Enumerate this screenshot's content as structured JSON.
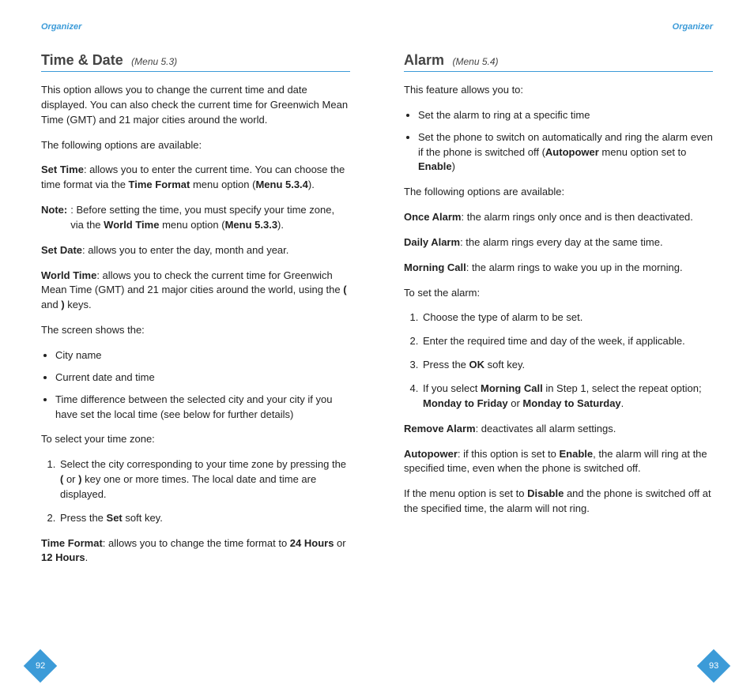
{
  "left": {
    "header": "Organizer",
    "title": "Time & Date",
    "menuRef": "(Menu 5.3)",
    "intro": "This option allows you to change the current time and date displayed. You can also check the current time for Greenwich Mean Time (GMT) and 21 major cities around the world.",
    "optionsIntro": "The following options are available:",
    "setTime": {
      "label": "Set Time",
      "text1": ": allows you to enter the current time. You can choose the time format via the ",
      "bold1": "Time Format",
      "text2": " menu option (",
      "bold2": "Menu 5.3.4",
      "text3": ")."
    },
    "note": {
      "label": "Note",
      "text1": ": Before setting the time, you must specify your time zone, via the ",
      "bold1": "World Time",
      "text2": " menu option (",
      "bold2": "Menu 5.3.3",
      "text3": ")."
    },
    "setDate": {
      "label": "Set Date",
      "text": ": allows you to enter the day, month and year."
    },
    "worldTime": {
      "label": "World Time",
      "text1": ": allows you to check the current time for Greenwich Mean Time (GMT) and 21 major cities around the world, using the ",
      "key1": "(",
      "mid": " and ",
      "key2": ")",
      "text2": " keys."
    },
    "screenShows": "The screen shows the:",
    "bullets": [
      "City name",
      "Current date and time",
      "Time difference between the selected city and your city if you have set the local time (see below for further details)"
    ],
    "selectZone": "To select your time zone:",
    "steps": {
      "s1a": "Select the city corresponding to your time zone by pressing the ",
      "s1k1": "(",
      "s1mid": " or ",
      "s1k2": ")",
      "s1b": " key one or more times. The local date and time are displayed.",
      "s2a": "Press the ",
      "s2b": "Set",
      "s2c": " soft key."
    },
    "timeFormat": {
      "label": "Time Format",
      "text1": ": allows you to change the time format to ",
      "bold1": "24 Hours",
      "mid": " or ",
      "bold2": "12 Hours",
      "end": "."
    },
    "pageNum": "92"
  },
  "right": {
    "header": "Organizer",
    "title": "Alarm",
    "menuRef": "(Menu 5.4)",
    "intro": "This feature allows you to:",
    "introBullets": {
      "b1": "Set the alarm to ring at a specific time",
      "b2a": "Set the phone to switch on automatically and ring the alarm even if the phone is switched off (",
      "b2b1": "Autopower",
      "b2mid": " menu option set to ",
      "b2b2": "Enable",
      "b2end": ")"
    },
    "optionsIntro": "The following options are available:",
    "once": {
      "label": "Once Alarm",
      "text": ": the alarm rings only once and is then deactivated."
    },
    "daily": {
      "label": "Daily Alarm",
      "text": ": the alarm rings every day at the same time."
    },
    "morning": {
      "label": "Morning Call",
      "text": ": the alarm rings to wake you up in the morning."
    },
    "toSet": "To set the alarm:",
    "steps": {
      "s1": "Choose the type of alarm to be set.",
      "s2": "Enter the required time and day of the week, if applicable.",
      "s3a": "Press the ",
      "s3b": "OK",
      "s3c": " soft key.",
      "s4a": "If you select ",
      "s4b1": "Morning Call",
      "s4mid1": " in Step 1, select the repeat option; ",
      "s4b2": "Monday to Friday",
      "s4mid2": " or ",
      "s4b3": "Monday to Saturday",
      "s4end": "."
    },
    "remove": {
      "label": "Remove Alarm",
      "text": ": deactivates all alarm settings."
    },
    "autopower": {
      "label": "Autopower",
      "text1": ": if this option is set to ",
      "bold1": "Enable",
      "text2": ", the alarm will ring at the specified time, even when the phone is switched off."
    },
    "disable": {
      "text1": "If the menu option is set to ",
      "bold1": "Disable",
      "text2": " and the phone is switched off at the specified time, the alarm will not ring."
    },
    "pageNum": "93"
  }
}
